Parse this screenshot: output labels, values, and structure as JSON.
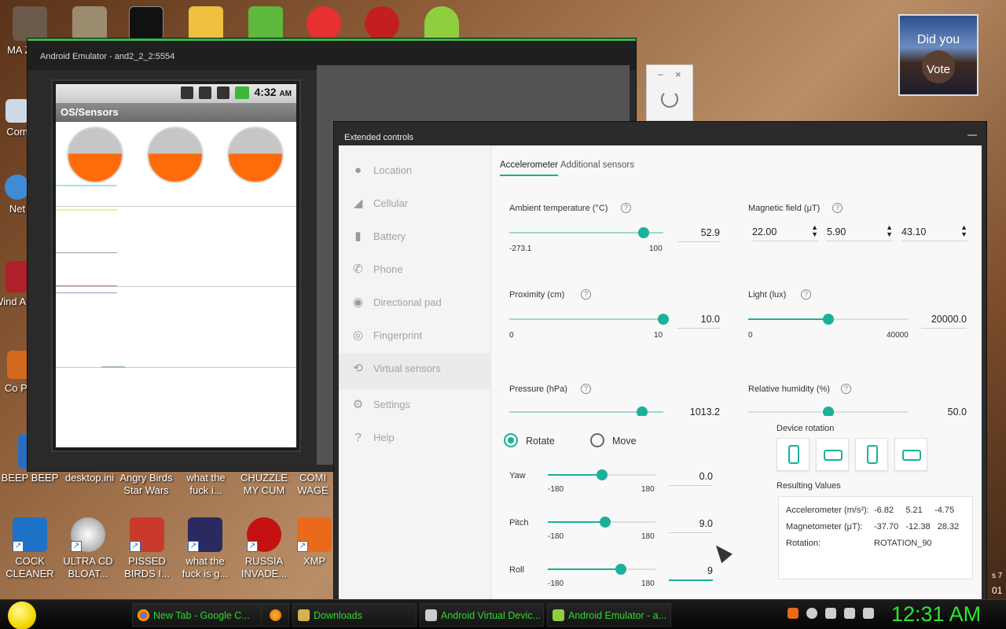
{
  "colors": {
    "accent": "#1bb09a",
    "orange": "#fe6b0a",
    "taskbar_text": "#2fd92f"
  },
  "desktop": {
    "icons_left_col": [
      {
        "label": "MA ZUCK",
        "icon": "photo-icon"
      },
      {
        "label": "Com",
        "icon": "computer-icon"
      },
      {
        "label": "Net",
        "icon": "network-icon"
      },
      {
        "label": "Wind AND",
        "icon": "wine-icon"
      },
      {
        "label": "Co Pa",
        "icon": "control-panel-icon"
      },
      {
        "label": "BEEP BEEP",
        "icon": "beep-icon"
      }
    ],
    "icons_mid_row": [
      {
        "label": "desktop.ini"
      },
      {
        "label": "Angry Birds Star Wars"
      },
      {
        "label": "what the fuck i..."
      },
      {
        "label": "CHUZZLE MY CUM"
      },
      {
        "label": "COMI WAGE"
      }
    ],
    "icons_bottom_row": [
      {
        "label": "COCK CLEANER"
      },
      {
        "label": "ULTRA CD BLOAT..."
      },
      {
        "label": "PISSED BIRDS I..."
      },
      {
        "label": "what the fuck is g..."
      },
      {
        "label": "RUSSIA INVADE..."
      },
      {
        "label": "XMP"
      }
    ],
    "thumb_text": {
      "line1": "Did you",
      "line2": "Vote"
    },
    "side_text": {
      "line1": "s 7",
      "line2": "01"
    }
  },
  "emulator": {
    "title": "Android Emulator - and2_2_2:5554",
    "status_time": "4:32",
    "status_ampm": "AM",
    "app_title": "OS/Sensors"
  },
  "extended": {
    "title": "Extended controls",
    "nav": [
      {
        "label": "Location",
        "icon": "location-icon"
      },
      {
        "label": "Cellular",
        "icon": "cellular-icon"
      },
      {
        "label": "Battery",
        "icon": "battery-icon"
      },
      {
        "label": "Phone",
        "icon": "phone-icon"
      },
      {
        "label": "Directional pad",
        "icon": "dpad-icon"
      },
      {
        "label": "Fingerprint",
        "icon": "fingerprint-icon"
      },
      {
        "label": "Virtual sensors",
        "icon": "virtual-sensors-icon"
      },
      {
        "label": "Settings",
        "icon": "settings-icon"
      },
      {
        "label": "Help",
        "icon": "help-icon"
      }
    ],
    "active_nav": "Virtual sensors",
    "tabs": {
      "accelerometer": "Accelerometer",
      "additional": "Additional sensors"
    },
    "ambient": {
      "label": "Ambient temperature (°C)",
      "min": "-273.1",
      "max": "100",
      "value": "52.9",
      "fraction": 0.87
    },
    "magnetic": {
      "label": "Magnetic field (μT)",
      "x": "22.00",
      "y": "5.90",
      "z": "43.10"
    },
    "proximity": {
      "label": "Proximity (cm)",
      "min": "0",
      "max": "10",
      "value": "10.0",
      "fraction": 1.0
    },
    "light": {
      "label": "Light (lux)",
      "min": "0",
      "max": "40000",
      "value": "20000.0",
      "fraction": 0.5
    },
    "pressure": {
      "label": "Pressure (hPa)",
      "value": "1013.2"
    },
    "humidity": {
      "label": "Relative humidity (%)",
      "value": "50.0"
    },
    "mode": {
      "rotate": "Rotate",
      "move": "Move",
      "selected": "Rotate"
    },
    "yaw": {
      "label": "Yaw",
      "min": "-180",
      "max": "180",
      "value": "0.0",
      "fraction": 0.5
    },
    "pitch": {
      "label": "Pitch",
      "min": "-180",
      "max": "180",
      "value": "9.0",
      "fraction": 0.53
    },
    "roll": {
      "label": "Roll",
      "min": "-180",
      "max": "180",
      "value": "9",
      "fraction": 0.68
    },
    "device_rotation_label": "Device rotation",
    "resulting_values_label": "Resulting Values",
    "results": {
      "accel_label": "Accelerometer (m/s²):",
      "accel_x": "-6.82",
      "accel_y": "5.21",
      "accel_z": "-4.75",
      "mag_label": "Magnetometer (μT):",
      "mag_x": "-37.70",
      "mag_y": "-12.38",
      "mag_z": "28.32",
      "rot_label": "Rotation:",
      "rot_value": "ROTATION_90"
    }
  },
  "taskbar": {
    "tasks": [
      {
        "label": "New Tab - Google C...",
        "icon": "chrome-icon"
      },
      {
        "label": "",
        "icon": "firefox-icon"
      },
      {
        "label": "Downloads",
        "icon": "folder-icon"
      },
      {
        "label": "Android Virtual Devic...",
        "icon": "avd-icon"
      },
      {
        "label": "Android Emulator - a...",
        "icon": "emulator-icon"
      }
    ],
    "clock": "12:31 AM"
  }
}
